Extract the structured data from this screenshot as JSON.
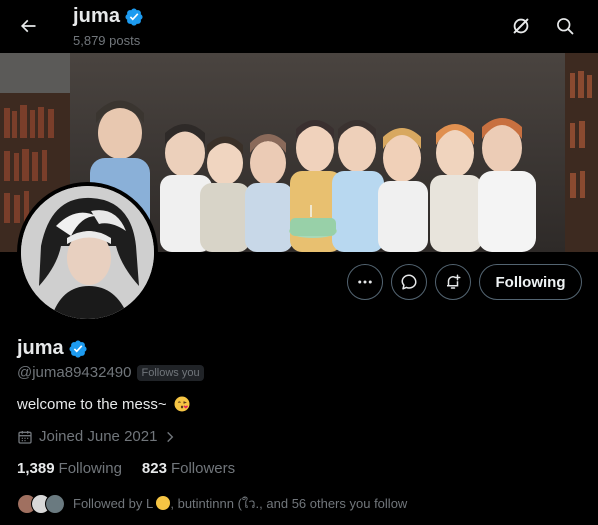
{
  "header": {
    "name": "juma",
    "posts_count": "5,879 posts"
  },
  "profile": {
    "display_name": "juma",
    "handle": "@juma89432490",
    "follows_you_badge": "Follows you",
    "bio": "welcome to the mess~",
    "bio_emoji": "kissing-face",
    "joined": "Joined June 2021",
    "following_count": "1,389",
    "following_label": "Following",
    "followers_count": "823",
    "followers_label": "Followers",
    "followed_by_prefix": "Followed by L",
    "followed_by_suffix": ", butintinnn (ใว., and 56 others you follow"
  },
  "actions": {
    "following_button": "Following"
  },
  "colors": {
    "verified_blue": "#1d9bf0",
    "muted_text": "#71767b",
    "border": "#536471"
  },
  "icons": [
    "back-arrow-icon",
    "grok-icon",
    "search-icon",
    "more-icon",
    "message-icon",
    "notification-bell-icon",
    "calendar-icon",
    "chevron-right-icon",
    "verified-badge-icon"
  ]
}
